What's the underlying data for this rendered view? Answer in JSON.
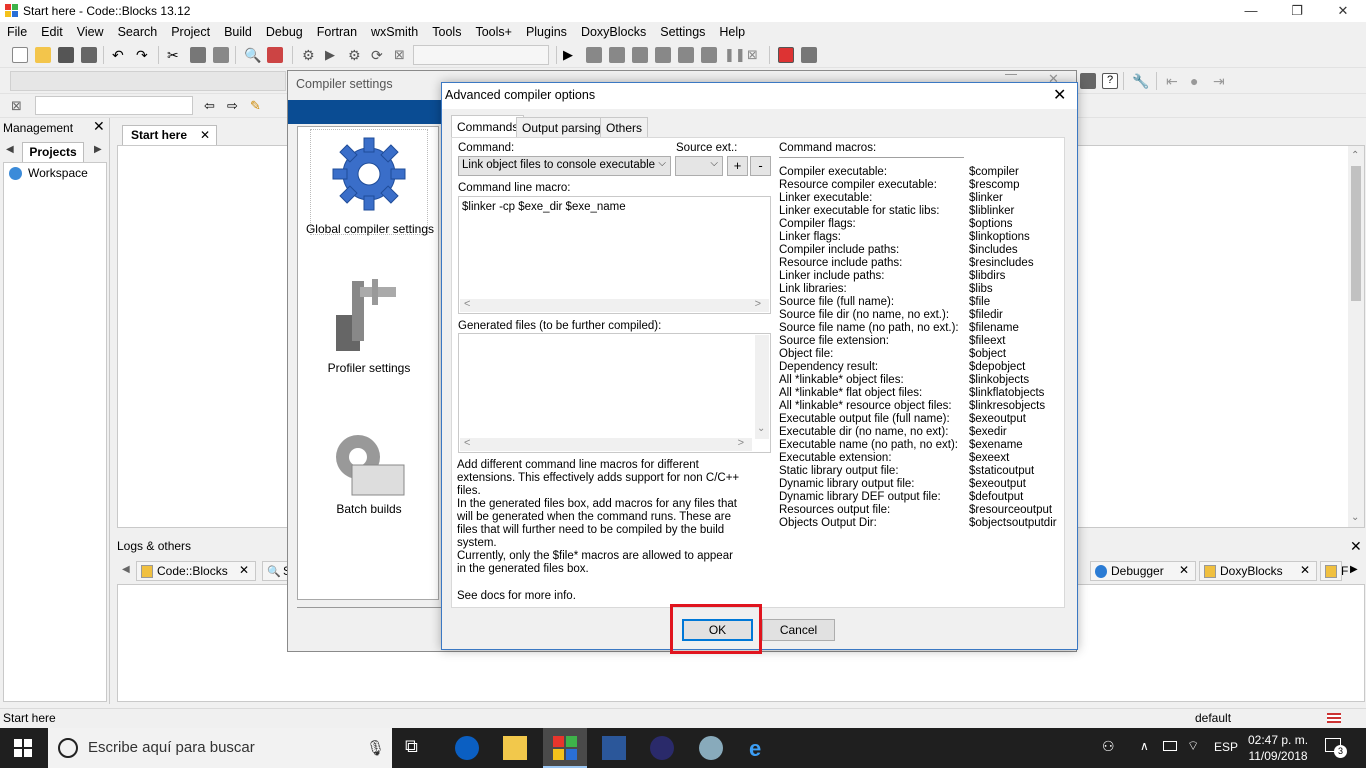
{
  "window": {
    "title": "Start here - Code::Blocks 13.12",
    "minimize": "—",
    "maximize": "❐",
    "close": "✕"
  },
  "menu": [
    "File",
    "Edit",
    "View",
    "Search",
    "Project",
    "Build",
    "Debug",
    "Fortran",
    "wxSmith",
    "Tools",
    "Tools+",
    "Plugins",
    "DoxyBlocks",
    "Settings",
    "Help"
  ],
  "management": {
    "title": "Management",
    "close": "✕",
    "tab": "Projects",
    "tree_root": "Workspace"
  },
  "editor": {
    "tab": "Start here",
    "tab_close": "✕"
  },
  "logs": {
    "title": "Logs & others",
    "close": "✕",
    "tabs_left": [
      {
        "label": "Code::Blocks",
        "close": "✕"
      },
      {
        "label": "S",
        "close": ""
      }
    ],
    "tabs_right": [
      {
        "label": "Debugger",
        "close": "✕"
      },
      {
        "label": "DoxyBlocks",
        "close": "✕"
      },
      {
        "label": "F",
        "close": ""
      }
    ]
  },
  "statusbar": {
    "left": "Start here",
    "right": "default"
  },
  "taskbar": {
    "search_placeholder": "Escribe aquí para buscar",
    "lang": "ESP",
    "time": "02:47 p. m.",
    "date": "11/09/2018",
    "notifications": "3"
  },
  "compiler_settings": {
    "title": "Compiler settings",
    "items": [
      {
        "label": "Global compiler settings"
      },
      {
        "label": "Profiler settings"
      },
      {
        "label": "Batch builds"
      }
    ]
  },
  "advanced": {
    "title": "Advanced compiler options",
    "close": "✕",
    "tabs": [
      "Commands",
      "Output parsing",
      "Others"
    ],
    "command_label": "Command:",
    "command_value": "Link object files to console executable",
    "source_ext_label": "Source ext.:",
    "source_ext_value": "",
    "add_btn": "+",
    "remove_btn": "-",
    "cmd_macro_label": "Command line macro:",
    "cmd_macro_value": "$linker -cp $exe_dir $exe_name",
    "generated_label": "Generated files (to be further compiled):",
    "generated_value": "",
    "help_lines": [
      "Add different command line macros for different",
      "extensions. This effectively adds support for non C/C++",
      "files.",
      "In the generated files box, add macros for any files that",
      "will be generated when the command runs. These are",
      "files that will further need to be compiled by the build",
      "system.",
      "Currently, only the $file* macros are allowed to appear",
      "in the generated files box."
    ],
    "docs": "See docs for more info.",
    "macros_title": "Command macros:",
    "macros": [
      [
        "Compiler executable:",
        "$compiler"
      ],
      [
        "Resource compiler executable:",
        "$rescomp"
      ],
      [
        "Linker executable:",
        "$linker"
      ],
      [
        "Linker executable for static libs:",
        "$liblinker"
      ],
      [
        "Compiler flags:",
        "$options"
      ],
      [
        "Linker flags:",
        "$linkoptions"
      ],
      [
        "Compiler include paths:",
        "$includes"
      ],
      [
        "Resource include paths:",
        "$resincludes"
      ],
      [
        "Linker include paths:",
        "$libdirs"
      ],
      [
        "Link libraries:",
        "$libs"
      ],
      [
        "Source file (full name):",
        "$file"
      ],
      [
        "Source file dir (no name, no ext.):",
        "$filedir"
      ],
      [
        "Source file name (no path, no ext.):",
        "$filename"
      ],
      [
        "Source file extension:",
        "$fileext"
      ],
      [
        "Object file:",
        "$object"
      ],
      [
        "Dependency result:",
        "$depobject"
      ],
      [
        "All *linkable* object files:",
        "$linkobjects"
      ],
      [
        "All *linkable* flat object files:",
        "$linkflatobjects"
      ],
      [
        "All *linkable* resource object files:",
        "$linkresobjects"
      ],
      [
        "Executable output file (full name):",
        "$exeoutput"
      ],
      [
        "Executable dir (no name, no ext):",
        "$exedir"
      ],
      [
        "Executable name (no path, no ext):",
        "$exename"
      ],
      [
        "Executable extension:",
        "$exeext"
      ],
      [
        "Static library output file:",
        "$staticoutput"
      ],
      [
        "Dynamic library output file:",
        "$exeoutput"
      ],
      [
        "Dynamic library DEF output file:",
        "$defoutput"
      ],
      [
        "Resources output file:",
        "$resourceoutput"
      ],
      [
        "Objects Output Dir:",
        "$objectsoutputdir"
      ]
    ],
    "ok": "OK",
    "cancel": "Cancel"
  }
}
